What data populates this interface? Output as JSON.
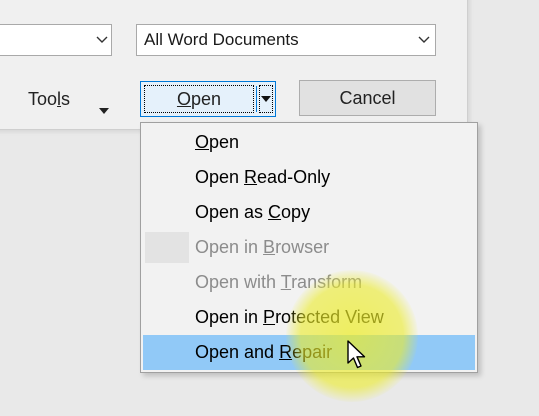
{
  "dialog": {
    "filename_combo": {
      "value": ""
    },
    "filetype_combo": {
      "value": "All Word Documents"
    },
    "tools": {
      "label_pre": "Too",
      "label_mn": "l",
      "label_post": "s"
    },
    "open_button": {
      "label_mn": "O",
      "label_post": "pen"
    },
    "cancel_button": {
      "label": "Cancel"
    }
  },
  "menu": {
    "items": [
      {
        "pre": "",
        "mn": "O",
        "post": "pen",
        "state": "enabled"
      },
      {
        "pre": "Open ",
        "mn": "R",
        "post": "ead-Only",
        "state": "enabled"
      },
      {
        "pre": "Open as ",
        "mn": "C",
        "post": "opy",
        "state": "enabled"
      },
      {
        "pre": "Open in ",
        "mn": "B",
        "post": "rowser",
        "state": "disabled"
      },
      {
        "pre": "Open with ",
        "mn": "T",
        "post": "ransform",
        "state": "disabled"
      },
      {
        "pre": "Open in ",
        "mn": "P",
        "post": "rotected View",
        "state": "enabled"
      },
      {
        "pre": "Open and ",
        "mn": "R",
        "post": "epair",
        "state": "highlighted"
      }
    ]
  },
  "colors": {
    "highlight": "#91c9f7",
    "focus_border": "#0078d7",
    "disabled_text": "#8c8c8c",
    "cursor_halo": "#ecec28"
  },
  "icons": [
    "chevron-down-icon",
    "caret-down-icon",
    "mouse-pointer-icon"
  ]
}
